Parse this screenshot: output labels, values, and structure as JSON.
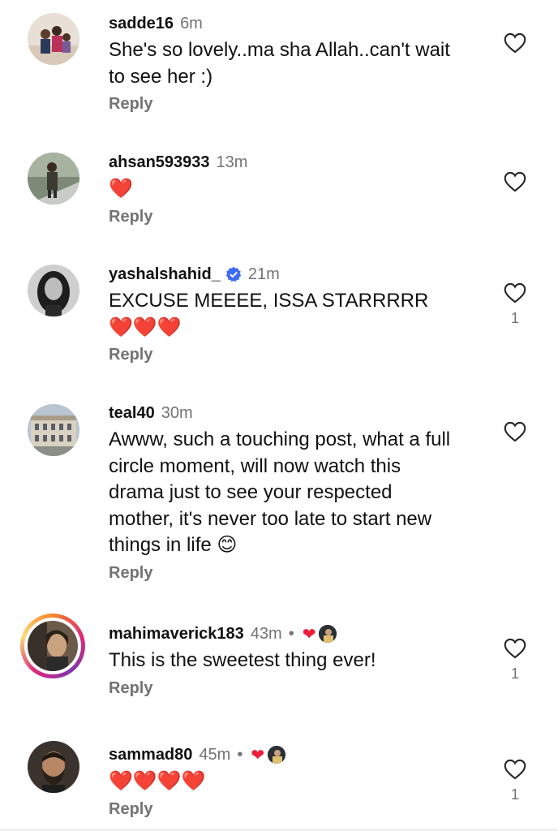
{
  "colors": {
    "accent_heart": "#ed1c3a",
    "muted": "#737373",
    "verified": "#3f6cf6"
  },
  "comments": [
    {
      "username": "sadde16",
      "time": "6m",
      "verified": false,
      "creator_liked": false,
      "text": "She's so lovely..ma sha Allah..can't wait to see her :)",
      "reply": "Reply",
      "likes": ""
    },
    {
      "username": "ahsan593933",
      "time": "13m",
      "verified": false,
      "creator_liked": false,
      "text": "❤️",
      "reply": "Reply",
      "likes": ""
    },
    {
      "username": "yashalshahid_",
      "time": "21m",
      "verified": true,
      "creator_liked": false,
      "text": "EXCUSE MEEEE, ISSA STARRRRR ❤️❤️❤️",
      "reply": "Reply",
      "likes": "1"
    },
    {
      "username": "teal40",
      "time": "30m",
      "verified": false,
      "creator_liked": false,
      "text": "Awww, such a touching post, what a full circle moment, will now watch this drama just to see your respected mother, it's never too late to start new things in life 😊",
      "reply": "Reply",
      "likes": ""
    },
    {
      "username": "mahimaverick183",
      "time": "43m",
      "verified": false,
      "creator_liked": true,
      "dot": "•",
      "text": "This is the sweetest thing ever!",
      "reply": "Reply",
      "likes": "1"
    },
    {
      "username": "sammad80",
      "time": "45m",
      "verified": false,
      "creator_liked": true,
      "dot": "•",
      "text": "❤️❤️❤️❤️",
      "reply": "Reply",
      "likes": "1"
    }
  ]
}
